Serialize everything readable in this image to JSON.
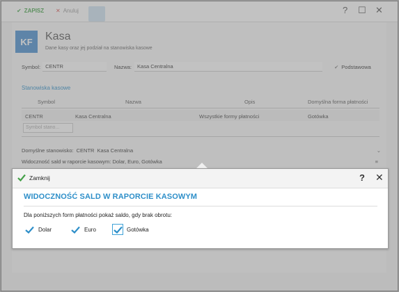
{
  "background": {
    "toolbar": {
      "save_label": "ZAPISZ",
      "cancel_label": "Anuluj",
      "help": "?",
      "close": "✕"
    },
    "header": {
      "badge": "KF",
      "title": "Kasa",
      "subtitle": "Dane kasy oraz jej podział na stanowiska kasowe"
    },
    "fields": {
      "symbol_label": "Symbol:",
      "symbol_value": "CENTR",
      "name_label": "Nazwa:",
      "name_value": "Kasa Centralna",
      "default_label": "Podstawowa"
    },
    "stations": {
      "title": "Stanowiska kasowe",
      "columns": [
        "Symbol",
        "Nazwa",
        "Opis",
        "Domyślna forma płatności"
      ],
      "row": [
        "CENTR",
        "Kasa Centralna",
        "Wszystkie formy płatności",
        "Gotówka"
      ],
      "new_placeholder": "Symbol stano..."
    },
    "default_station": {
      "label": "Domyślne stanowisko:",
      "symbol": "CENTR",
      "name": "Kasa Centralna"
    },
    "visibility": {
      "label": "Widoczność sald w raporcie kasowym: Dolar, Euro, Gotówka"
    }
  },
  "popup": {
    "close_label": "Zamknij",
    "help": "?",
    "title": "WIDOCZNOŚĆ SALD W RAPORCIE KASOWYM",
    "description": "Dla poniższych form płatności pokaż saldo, gdy brak obrotu:",
    "options": [
      {
        "label": "Dolar",
        "checked": true
      },
      {
        "label": "Euro",
        "checked": true
      },
      {
        "label": "Gotówka",
        "checked": true
      }
    ]
  },
  "colors": {
    "accent": "#2e8fc9",
    "check": "#2e8fc9",
    "save_green": "#4aa64e"
  }
}
